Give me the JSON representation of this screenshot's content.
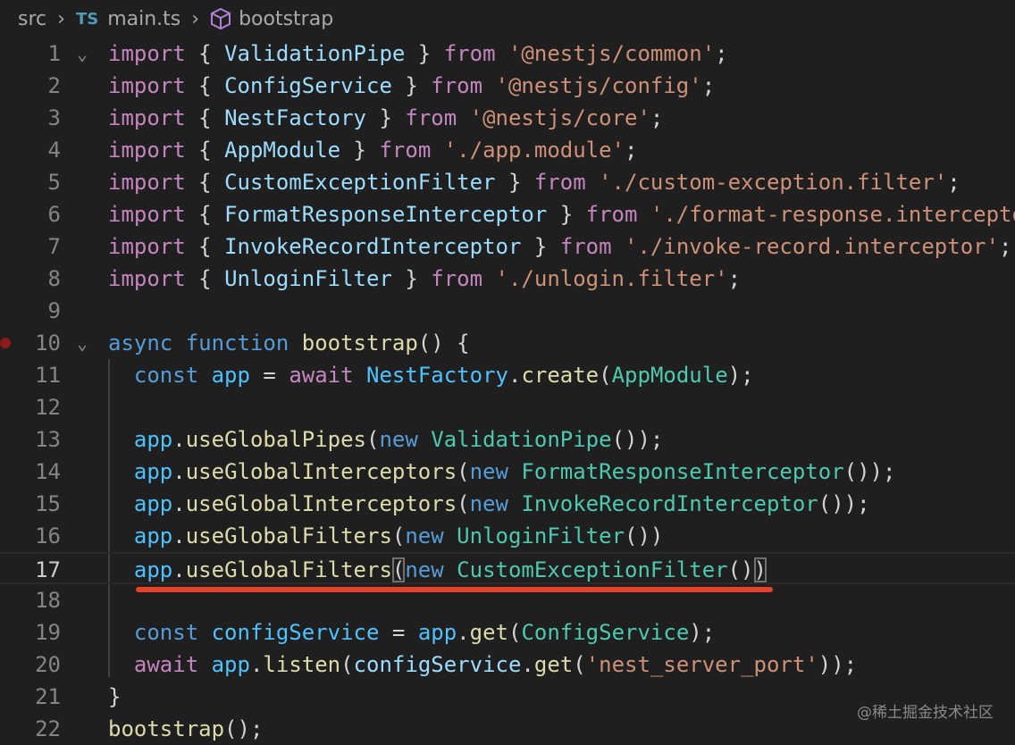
{
  "breadcrumb": {
    "folder": "src",
    "file_badge": "TS",
    "file": "main.ts",
    "symbol_icon": "cube-icon",
    "symbol": "bootstrap"
  },
  "active_line": 17,
  "breakpoint_line": 10,
  "folded_lines": [
    1,
    10
  ],
  "annotation_color": "#e8402a",
  "watermark": "@稀土掘金技术社区",
  "lines": [
    [
      [
        "import",
        "kw"
      ],
      [
        " { ",
        "p"
      ],
      [
        "ValidationPipe",
        "prop"
      ],
      [
        " } ",
        "p"
      ],
      [
        "from",
        "kw"
      ],
      [
        " ",
        "p"
      ],
      [
        "'@nestjs/common'",
        "st"
      ],
      [
        ";",
        "p"
      ]
    ],
    [
      [
        "import",
        "kw"
      ],
      [
        " { ",
        "p"
      ],
      [
        "ConfigService",
        "prop"
      ],
      [
        " } ",
        "p"
      ],
      [
        "from",
        "kw"
      ],
      [
        " ",
        "p"
      ],
      [
        "'@nestjs/config'",
        "st"
      ],
      [
        ";",
        "p"
      ]
    ],
    [
      [
        "import",
        "kw"
      ],
      [
        " { ",
        "p"
      ],
      [
        "NestFactory",
        "prop"
      ],
      [
        " } ",
        "p"
      ],
      [
        "from",
        "kw"
      ],
      [
        " ",
        "p"
      ],
      [
        "'@nestjs/core'",
        "st"
      ],
      [
        ";",
        "p"
      ]
    ],
    [
      [
        "import",
        "kw"
      ],
      [
        " { ",
        "p"
      ],
      [
        "AppModule",
        "prop"
      ],
      [
        " } ",
        "p"
      ],
      [
        "from",
        "kw"
      ],
      [
        " ",
        "p"
      ],
      [
        "'./app.module'",
        "st"
      ],
      [
        ";",
        "p"
      ]
    ],
    [
      [
        "import",
        "kw"
      ],
      [
        " { ",
        "p"
      ],
      [
        "CustomExceptionFilter",
        "prop"
      ],
      [
        " } ",
        "p"
      ],
      [
        "from",
        "kw"
      ],
      [
        " ",
        "p"
      ],
      [
        "'./custom-exception.filter'",
        "st"
      ],
      [
        ";",
        "p"
      ]
    ],
    [
      [
        "import",
        "kw"
      ],
      [
        " { ",
        "p"
      ],
      [
        "FormatResponseInterceptor",
        "prop"
      ],
      [
        " } ",
        "p"
      ],
      [
        "from",
        "kw"
      ],
      [
        " ",
        "p"
      ],
      [
        "'./format-response.interceptor'",
        "st"
      ],
      [
        ";",
        "p"
      ]
    ],
    [
      [
        "import",
        "kw"
      ],
      [
        " { ",
        "p"
      ],
      [
        "InvokeRecordInterceptor",
        "prop"
      ],
      [
        " } ",
        "p"
      ],
      [
        "from",
        "kw"
      ],
      [
        " ",
        "p"
      ],
      [
        "'./invoke-record.interceptor'",
        "st"
      ],
      [
        ";",
        "p"
      ]
    ],
    [
      [
        "import",
        "kw"
      ],
      [
        " { ",
        "p"
      ],
      [
        "UnloginFilter",
        "prop"
      ],
      [
        " } ",
        "p"
      ],
      [
        "from",
        "kw"
      ],
      [
        " ",
        "p"
      ],
      [
        "'./unlogin.filter'",
        "st"
      ],
      [
        ";",
        "p"
      ]
    ],
    [],
    [
      [
        "async",
        "sk"
      ],
      [
        " ",
        "p"
      ],
      [
        "function",
        "sk"
      ],
      [
        " ",
        "p"
      ],
      [
        "bootstrap",
        "fn"
      ],
      [
        "() {",
        "p"
      ]
    ],
    [
      [
        "  ",
        "p"
      ],
      [
        "const",
        "sk"
      ],
      [
        " ",
        "p"
      ],
      [
        "app",
        "var"
      ],
      [
        " = ",
        "p"
      ],
      [
        "await",
        "kw"
      ],
      [
        " ",
        "p"
      ],
      [
        "NestFactory",
        "var"
      ],
      [
        ".",
        "p"
      ],
      [
        "create",
        "fn"
      ],
      [
        "(",
        "p"
      ],
      [
        "AppModule",
        "cls"
      ],
      [
        ");",
        "p"
      ]
    ],
    [],
    [
      [
        "  ",
        "p"
      ],
      [
        "app",
        "var"
      ],
      [
        ".",
        "p"
      ],
      [
        "useGlobalPipes",
        "fn"
      ],
      [
        "(",
        "p"
      ],
      [
        "new",
        "sk"
      ],
      [
        " ",
        "p"
      ],
      [
        "ValidationPipe",
        "cls"
      ],
      [
        "());",
        "p"
      ]
    ],
    [
      [
        "  ",
        "p"
      ],
      [
        "app",
        "var"
      ],
      [
        ".",
        "p"
      ],
      [
        "useGlobalInterceptors",
        "fn"
      ],
      [
        "(",
        "p"
      ],
      [
        "new",
        "sk"
      ],
      [
        " ",
        "p"
      ],
      [
        "FormatResponseInterceptor",
        "cls"
      ],
      [
        "());",
        "p"
      ]
    ],
    [
      [
        "  ",
        "p"
      ],
      [
        "app",
        "var"
      ],
      [
        ".",
        "p"
      ],
      [
        "useGlobalInterceptors",
        "fn"
      ],
      [
        "(",
        "p"
      ],
      [
        "new",
        "sk"
      ],
      [
        " ",
        "p"
      ],
      [
        "InvokeRecordInterceptor",
        "cls"
      ],
      [
        "());",
        "p"
      ]
    ],
    [
      [
        "  ",
        "p"
      ],
      [
        "app",
        "var"
      ],
      [
        ".",
        "p"
      ],
      [
        "useGlobalFilters",
        "fn"
      ],
      [
        "(",
        "p"
      ],
      [
        "new",
        "sk"
      ],
      [
        " ",
        "p"
      ],
      [
        "UnloginFilter",
        "cls"
      ],
      [
        "())",
        "p"
      ]
    ],
    [
      [
        "  ",
        "p"
      ],
      [
        "app",
        "var"
      ],
      [
        ".",
        "p"
      ],
      [
        "useGlobalFilters",
        "fn"
      ],
      [
        "(",
        "pb"
      ],
      [
        "new",
        "sk"
      ],
      [
        " ",
        "p"
      ],
      [
        "CustomExceptionFilter",
        "cls"
      ],
      [
        "()",
        "p"
      ],
      [
        ")",
        "pb"
      ]
    ],
    [],
    [
      [
        "  ",
        "p"
      ],
      [
        "const",
        "sk"
      ],
      [
        " ",
        "p"
      ],
      [
        "configService",
        "var"
      ],
      [
        " = ",
        "p"
      ],
      [
        "app",
        "var"
      ],
      [
        ".",
        "p"
      ],
      [
        "get",
        "fn"
      ],
      [
        "(",
        "p"
      ],
      [
        "ConfigService",
        "cls"
      ],
      [
        ");",
        "p"
      ]
    ],
    [
      [
        "  ",
        "p"
      ],
      [
        "await",
        "kw"
      ],
      [
        " ",
        "p"
      ],
      [
        "app",
        "var"
      ],
      [
        ".",
        "p"
      ],
      [
        "listen",
        "fn"
      ],
      [
        "(",
        "p"
      ],
      [
        "configService",
        "prop"
      ],
      [
        ".",
        "p"
      ],
      [
        "get",
        "fn"
      ],
      [
        "(",
        "p"
      ],
      [
        "'nest_server_port'",
        "st"
      ],
      [
        "));",
        "p"
      ]
    ],
    [
      [
        "}",
        "p"
      ]
    ],
    [
      [
        "bootstrap",
        "fn"
      ],
      [
        "();",
        "p"
      ]
    ]
  ]
}
